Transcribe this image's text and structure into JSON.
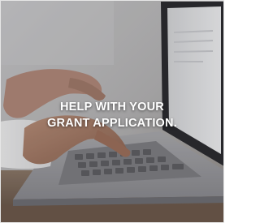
{
  "caption": {
    "line1": "HELP WITH YOUR",
    "line2": "GRANT APPLICATION."
  },
  "photo": {
    "subject": "hands typing on a laptop keyboard"
  }
}
